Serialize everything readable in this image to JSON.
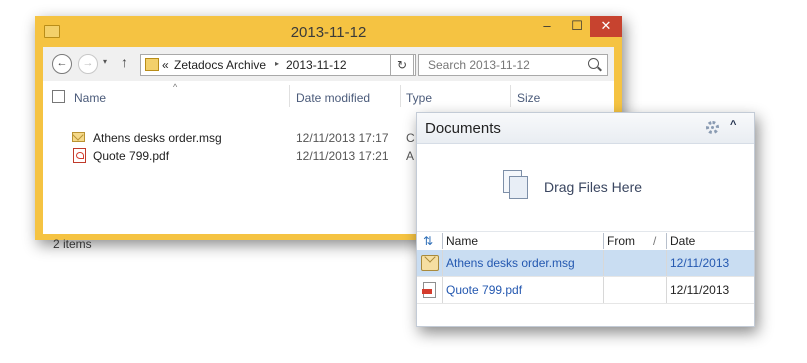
{
  "explorer": {
    "title": "2013-11-12",
    "controls": {
      "minimize": "–",
      "maximize": "☐",
      "close": "✕"
    },
    "nav": {
      "back": "←",
      "forward": "→",
      "recent": "▾",
      "up": "↑",
      "refresh": "↻"
    },
    "address": {
      "overflow": "«",
      "crumbs": [
        "Zetadocs Archive",
        "2013-11-12"
      ],
      "separator": "▸",
      "dropdown": "∨"
    },
    "search": {
      "placeholder": "Search 2013-11-12"
    },
    "columns": {
      "sort_caret": "^",
      "name": "Name",
      "date_modified": "Date modified",
      "type": "Type",
      "size": "Size"
    },
    "files": [
      {
        "name": "Athens desks order.msg",
        "date_modified": "12/11/2013 17:17",
        "type": "C",
        "icon": "envelope-icon"
      },
      {
        "name": "Quote 799.pdf",
        "date_modified": "12/11/2013 17:21",
        "type": "A",
        "icon": "pdf-icon"
      }
    ],
    "status": "2 items"
  },
  "documents": {
    "title": "Documents",
    "collapse": "^",
    "drop_text": "Drag Files Here",
    "columns": {
      "sync": "⇅",
      "name": "Name",
      "from": "From",
      "sort": "/",
      "date": "Date"
    },
    "rows": [
      {
        "name": "Athens desks order.msg",
        "from": "",
        "date": "12/11/2013",
        "selected": true,
        "icon": "message-icon"
      },
      {
        "name": "Quote 799.pdf",
        "from": "",
        "date": "12/11/2013",
        "selected": false,
        "icon": "pdf-icon"
      }
    ]
  },
  "colors": {
    "window_frame": "#f5c342",
    "close_button": "#c7432f",
    "selection": "#c9ddf2",
    "link": "#2458b0"
  }
}
